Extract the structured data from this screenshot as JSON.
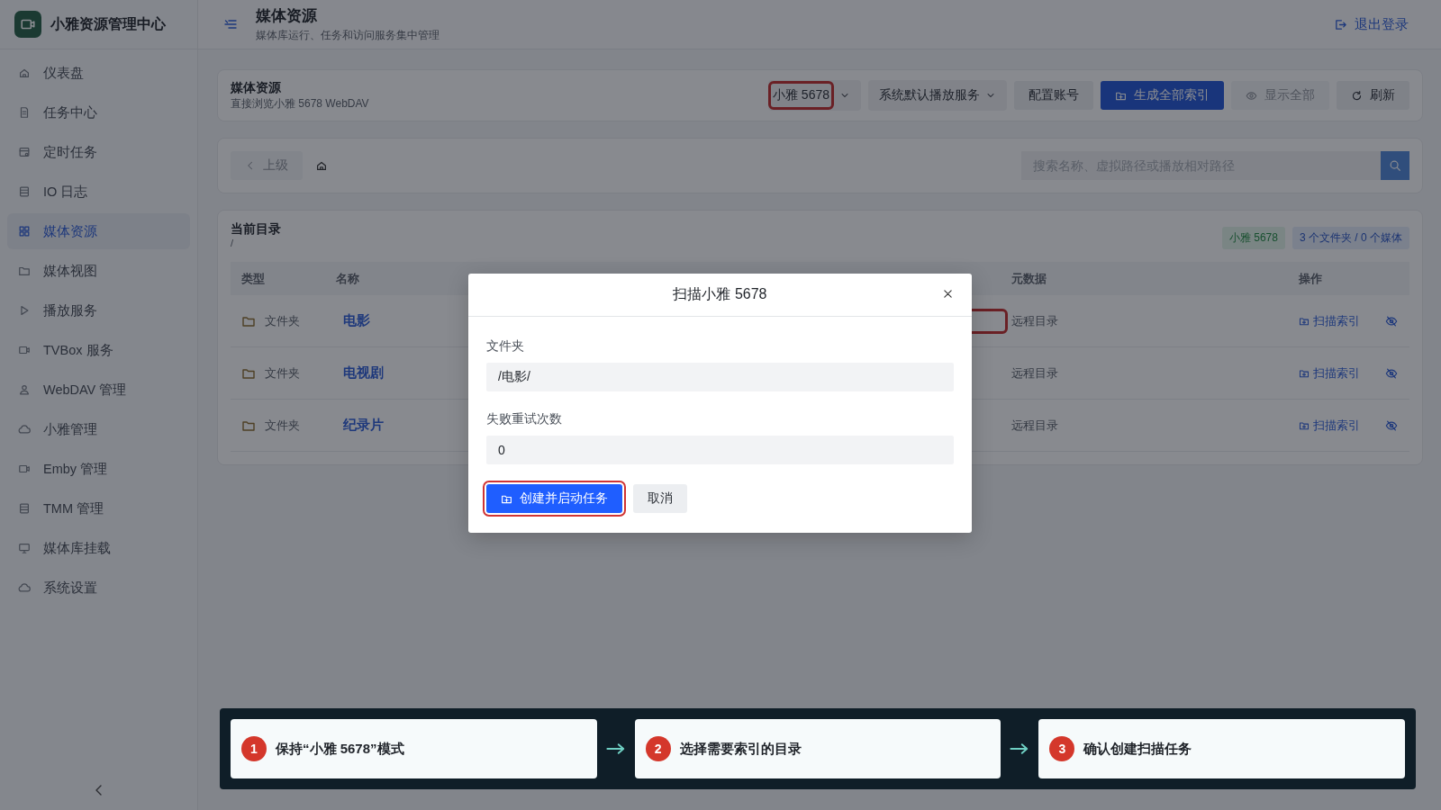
{
  "sidebar": {
    "brand": "小雅资源管理中心",
    "items": [
      {
        "label": "仪表盘",
        "selected": false
      },
      {
        "label": "任务中心",
        "selected": false
      },
      {
        "label": "定时任务",
        "selected": false
      },
      {
        "label": "IO 日志",
        "selected": false
      },
      {
        "label": "媒体资源",
        "selected": true
      },
      {
        "label": "媒体视图",
        "selected": false
      },
      {
        "label": "播放服务",
        "selected": false
      },
      {
        "label": "TVBox 服务",
        "selected": false
      },
      {
        "label": "WebDAV 管理",
        "selected": false
      },
      {
        "label": "小雅管理",
        "selected": false
      },
      {
        "label": "Emby 管理",
        "selected": false
      },
      {
        "label": "TMM 管理",
        "selected": false
      },
      {
        "label": "媒体库挂载",
        "selected": false
      },
      {
        "label": "系统设置",
        "selected": false
      }
    ]
  },
  "header": {
    "title": "媒体资源",
    "subtitle": "媒体库运行、任务和访问服务集中管理",
    "logout": "退出登录"
  },
  "toolbar": {
    "title": "媒体资源",
    "subtitle": "直接浏览小雅 5678 WebDAV",
    "source_select": {
      "value": "小雅 5678",
      "highlighted": true
    },
    "player_select": {
      "value": "系统默认播放服务"
    },
    "buttons": [
      {
        "label": "配置账号",
        "kind": "plain",
        "disabled": false
      },
      {
        "label": "生成全部索引",
        "kind": "primary",
        "disabled": false
      },
      {
        "label": "显示全部",
        "kind": "show",
        "disabled": true
      },
      {
        "label": "刷新",
        "kind": "refresh",
        "disabled": false
      }
    ]
  },
  "path_bar": {
    "up_button": {
      "label": "上级",
      "disabled": true
    },
    "search": {
      "placeholder": "搜索名称、虚拟路径或播放相对路径"
    }
  },
  "directory": {
    "title": "当前目录",
    "path": "/",
    "tags": [
      {
        "label": "小雅 5678",
        "kind": "source"
      },
      {
        "label": "3 个文件夹 / 0 个媒体",
        "kind": "count"
      }
    ],
    "columns": [
      "类型",
      "名称",
      "元数据",
      "操作"
    ],
    "rows": [
      {
        "type": "文件夹",
        "name": "电影",
        "metadata": "远程目录",
        "action": "扫描索引",
        "highlighted": true
      },
      {
        "type": "文件夹",
        "name": "电视剧",
        "metadata": "远程目录",
        "action": "扫描索引",
        "highlighted": false
      },
      {
        "type": "文件夹",
        "name": "纪录片",
        "metadata": "远程目录",
        "action": "扫描索引",
        "highlighted": false
      }
    ]
  },
  "dialog": {
    "title": "扫描小雅 5678",
    "fields": [
      {
        "label": "文件夹",
        "value": "/电影/"
      },
      {
        "label": "失败重试次数",
        "value": "0"
      }
    ],
    "confirm": {
      "label": "创建并启动任务",
      "highlighted": true
    },
    "cancel": "取消"
  },
  "steps": [
    {
      "number": "1",
      "text": "保持“小雅 5678”模式"
    },
    {
      "number": "2",
      "text": "选择需要索引的目录"
    },
    {
      "number": "3",
      "text": "确认创建扫描任务"
    }
  ]
}
